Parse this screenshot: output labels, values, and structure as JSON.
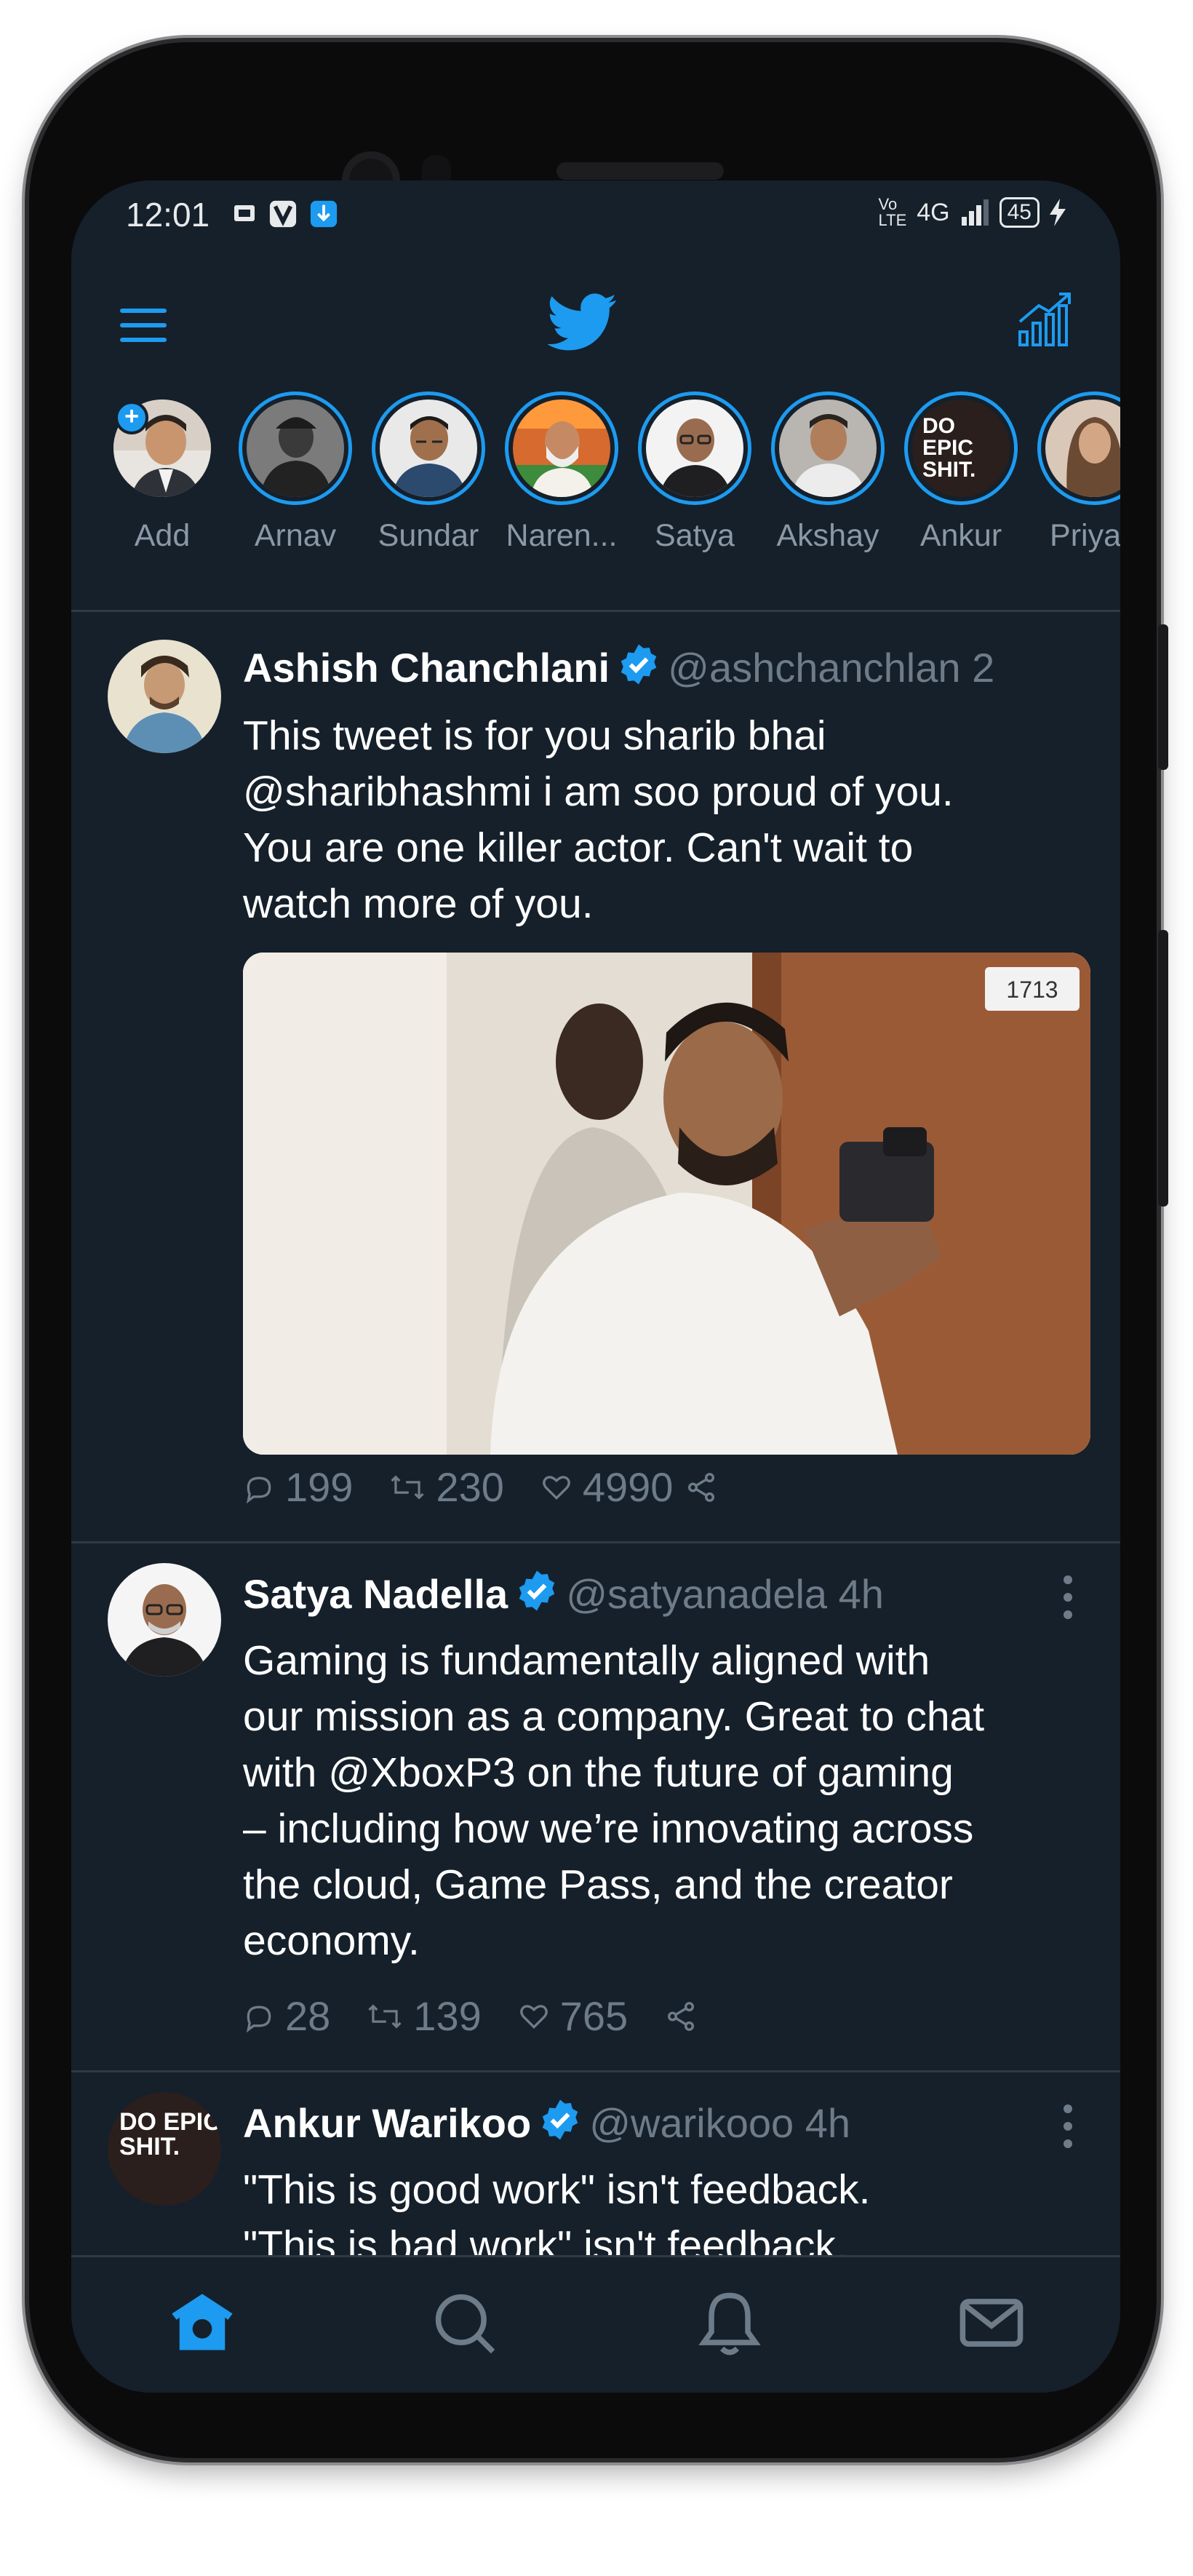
{
  "status_bar": {
    "time": "12:01",
    "network": "4G",
    "battery": "45"
  },
  "header": {
    "menu_icon": "hamburger-menu-icon",
    "logo_icon": "twitter-bird-icon",
    "trends_icon": "analytics-chart-icon"
  },
  "fleets": [
    {
      "name": "Add"
    },
    {
      "name": "Arnav"
    },
    {
      "name": "Sundar"
    },
    {
      "name": "Naren..."
    },
    {
      "name": "Satya"
    },
    {
      "name": "Akshay"
    },
    {
      "name": "Ankur",
      "avatar_text": "DO EPIC SHIT."
    },
    {
      "name": "Priyan"
    }
  ],
  "tweets": [
    {
      "name": "Ashish Chanchlani",
      "handle": "@ashchanchlan",
      "time": "2",
      "text": "This tweet is for you sharib bhai\n@sharibhashmi i am soo proud of you.\nYou are one killer actor. Can't wait to\nwatch more of you.",
      "replies": "199",
      "retweets": "230",
      "likes": "4990",
      "image_tag": "1713"
    },
    {
      "name": "Satya Nadella",
      "handle": "@satyanadela",
      "time": "4h",
      "text": "Gaming is fundamentally aligned with\nour mission as a company. Great to chat\nwith @XboxP3 on the future of gaming\n– including how we’re innovating across\nthe cloud, Game Pass, and the creator\neconomy.",
      "replies": "28",
      "retweets": "139",
      "likes": "765"
    },
    {
      "name": "Ankur Warikoo",
      "handle": "@warikooo",
      "time": "4h",
      "avatar_text": "DO EPIC SHIT.",
      "text": "\"This is good work\" isn't feedback.\n\"This is bad work\" isn't feedback."
    }
  ],
  "bottom_nav": [
    "home-icon",
    "search-icon",
    "notifications-icon",
    "messages-icon"
  ],
  "colors": {
    "background": "#15202b",
    "accent": "#1d9bf0",
    "muted": "#6e7c89",
    "divider": "#2f3a44"
  }
}
